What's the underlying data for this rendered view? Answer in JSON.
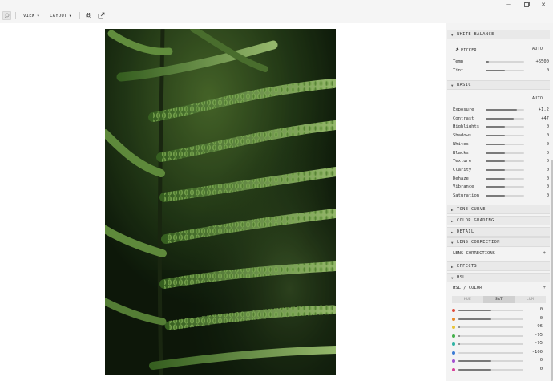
{
  "window": {
    "minimize_glyph": "—",
    "maximize_glyph": "❐",
    "close_glyph": "✕"
  },
  "toolbar": {
    "view_label": "VIEW",
    "layout_label": "LAYOUT",
    "icons": [
      "zoom-icon",
      "settings-icon",
      "export-icon"
    ]
  },
  "panel": {
    "white_balance": {
      "title": "WHITE BALANCE",
      "picker_label": "PICKER",
      "auto_label": "AUTO",
      "sliders": [
        {
          "name": "Temp",
          "value": "+6500",
          "level": 0.08
        },
        {
          "name": "Tint",
          "value": "0",
          "level": 0.5
        }
      ]
    },
    "basic": {
      "title": "BASIC",
      "auto_label": "AUTO",
      "sliders": [
        {
          "name": "Exposure",
          "value": "+1.2",
          "level": 0.81
        },
        {
          "name": "Contrast",
          "value": "+47",
          "level": 0.73
        },
        {
          "name": "Highlights",
          "value": "0",
          "level": 0.5
        },
        {
          "name": "Shadows",
          "value": "0",
          "level": 0.5
        },
        {
          "name": "Whites",
          "value": "0",
          "level": 0.5
        },
        {
          "name": "Blacks",
          "value": "0",
          "level": 0.5
        },
        {
          "name": "Texture",
          "value": "0",
          "level": 0.5
        },
        {
          "name": "Clarity",
          "value": "0",
          "level": 0.5
        },
        {
          "name": "Dehaze",
          "value": "0",
          "level": 0.5
        },
        {
          "name": "Vibrance",
          "value": "0",
          "level": 0.5
        },
        {
          "name": "Saturation",
          "value": "0",
          "level": 0.5
        }
      ]
    },
    "collapsed_sections": [
      "TONE CURVE",
      "COLOR GRADING",
      "DETAIL",
      "LENS CORRECTION"
    ],
    "lens_corrections_label": "LENS CORRECTIONS",
    "effects_title": "EFFECTS",
    "hsl": {
      "title": "HSL",
      "subtitle": "HSL / COLOR",
      "tabs": [
        "HUE",
        "SAT",
        "LUM"
      ],
      "active_tab": "SAT",
      "channels": [
        {
          "color": "#e0493a",
          "value": "0",
          "level": 0.5
        },
        {
          "color": "#e98b2a",
          "value": "0",
          "level": 0.5
        },
        {
          "color": "#e8c43a",
          "value": "-96",
          "level": 0.02
        },
        {
          "color": "#43b04a",
          "value": "-95",
          "level": 0.025
        },
        {
          "color": "#2fb3a4",
          "value": "-95",
          "level": 0.025
        },
        {
          "color": "#3a7bd5",
          "value": "-100",
          "level": 0.0
        },
        {
          "color": "#a24fd0",
          "value": "0",
          "level": 0.5
        },
        {
          "color": "#d9409a",
          "value": "0",
          "level": 0.5
        }
      ]
    }
  }
}
